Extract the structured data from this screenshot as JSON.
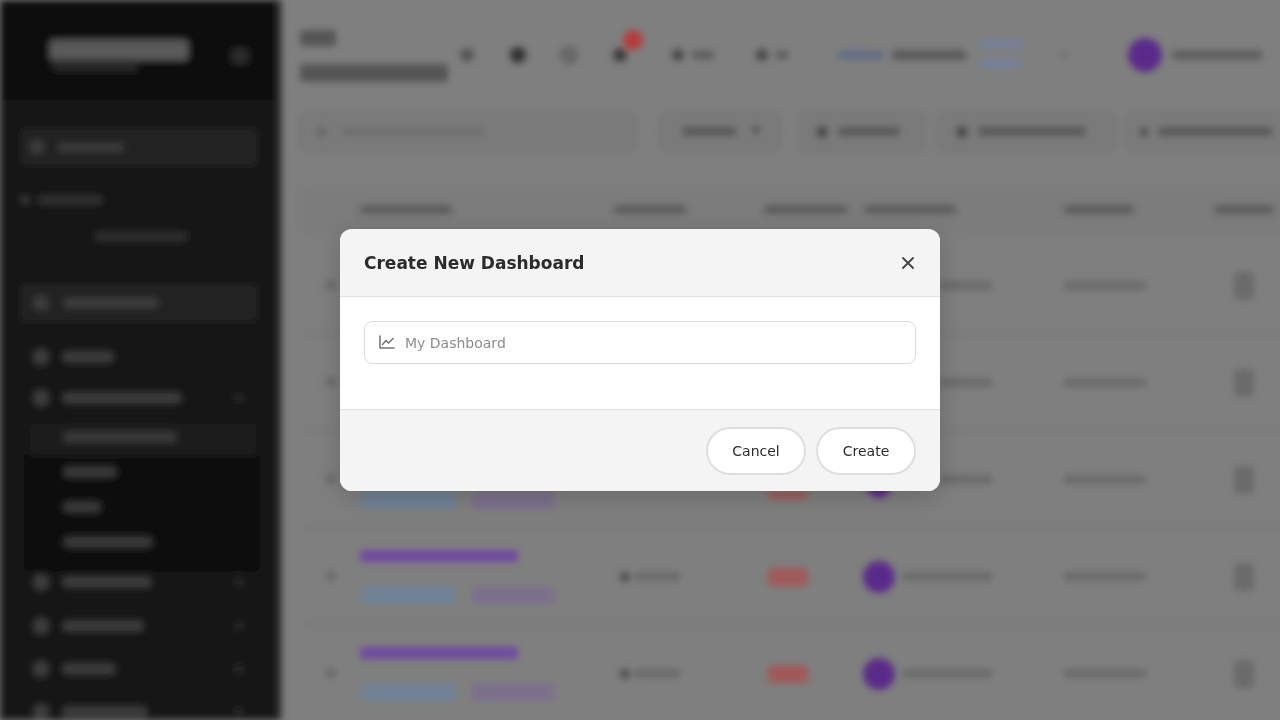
{
  "dialog": {
    "title": "Create New Dashboard",
    "name_field": {
      "placeholder": "My Dashboard"
    },
    "buttons": [
      "Cancel",
      "Create"
    ]
  }
}
